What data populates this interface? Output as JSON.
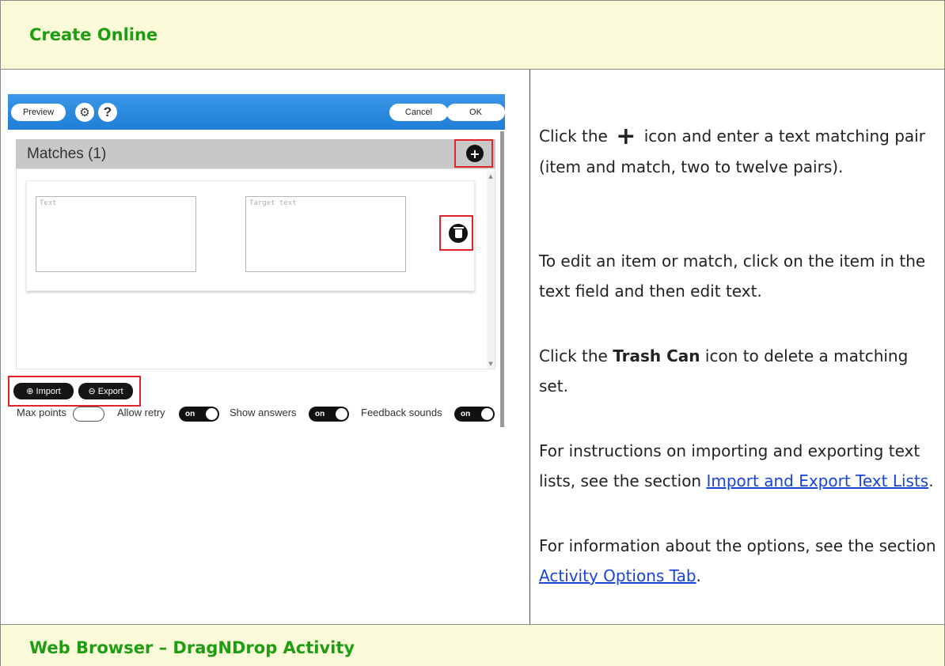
{
  "sections": {
    "top_heading": "Create Online",
    "bottom_heading": "Web Browser – DragNDrop Activity"
  },
  "editor": {
    "toolbar": {
      "preview_label": "Preview",
      "cancel_label": "Cancel",
      "ok_label": "OK",
      "gear_icon": "gear-icon",
      "help_label": "?"
    },
    "matches_title": "Matches (1)",
    "add_symbol": "+",
    "text_placeholder": "Text",
    "target_placeholder": "Target text",
    "import_label": "Import",
    "export_label": "Export",
    "options": {
      "max_points_label": "Max points",
      "allow_retry_label": "Allow retry",
      "show_answers_label": "Show answers",
      "feedback_sounds_label": "Feedback sounds",
      "toggle_on_text": "on"
    }
  },
  "instructions": {
    "p1_before": "Click the ",
    "plus_symbol": "+",
    "p1_after": " icon and enter a text matching pair (item and match, two to twelve pairs).",
    "p2": "To edit an item or match, click on the item in the text field and then edit text.",
    "p3_before": "Click the ",
    "p3_bold": "Trash Can",
    "p3_after": " icon to delete a matching set.",
    "p4_before": "For instructions on importing and exporting text lists, see the section ",
    "p4_link": "Import and Export Text Lists",
    "p4_after": ".",
    "p5_before": "For information about the options, see the section ",
    "p5_link": "Activity Options Tab",
    "p5_after": "."
  },
  "colors": {
    "heading_text": "#1e9d12",
    "heading_bg": "#fbfad9",
    "toolbar_blue": "#1f7fd6",
    "highlight_red": "#e0242b",
    "link": "#1a44d6"
  }
}
